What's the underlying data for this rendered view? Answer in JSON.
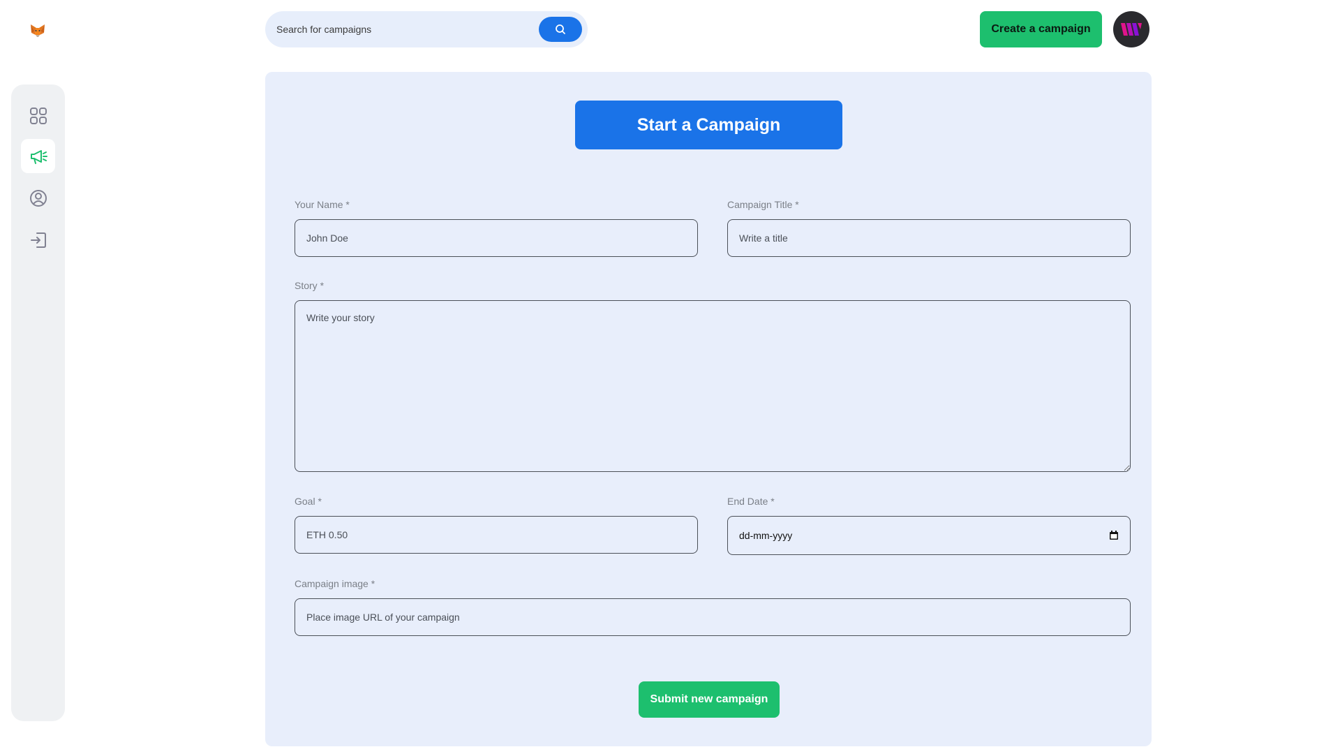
{
  "app": {
    "logo_icon": "metamask-fox-icon"
  },
  "sidebar": {
    "items": [
      {
        "icon": "dashboard-grid-icon",
        "active": false
      },
      {
        "icon": "megaphone-icon",
        "active": true
      },
      {
        "icon": "user-profile-icon",
        "active": false
      },
      {
        "icon": "logout-icon",
        "active": false
      }
    ]
  },
  "header": {
    "search_placeholder": "Search for campaigns",
    "search_icon": "search-icon",
    "create_label": "Create a campaign",
    "avatar_icon": "user-avatar-icon"
  },
  "form": {
    "title": "Start a Campaign",
    "name_label": "Your Name *",
    "name_placeholder": "John Doe",
    "campaign_title_label": "Campaign Title *",
    "campaign_title_placeholder": "Write a title",
    "story_label": "Story *",
    "story_placeholder": "Write your story",
    "goal_label": "Goal *",
    "goal_placeholder": "ETH 0.50",
    "end_date_label": "End Date *",
    "end_date_placeholder": "dd-mm-yyyy",
    "image_label": "Campaign image *",
    "image_placeholder": "Place image URL of your campaign",
    "submit_label": "Submit new campaign"
  },
  "colors": {
    "primary_blue": "#1a73e8",
    "accent_green": "#1dbf6e",
    "panel_bg": "#e8eefb"
  }
}
